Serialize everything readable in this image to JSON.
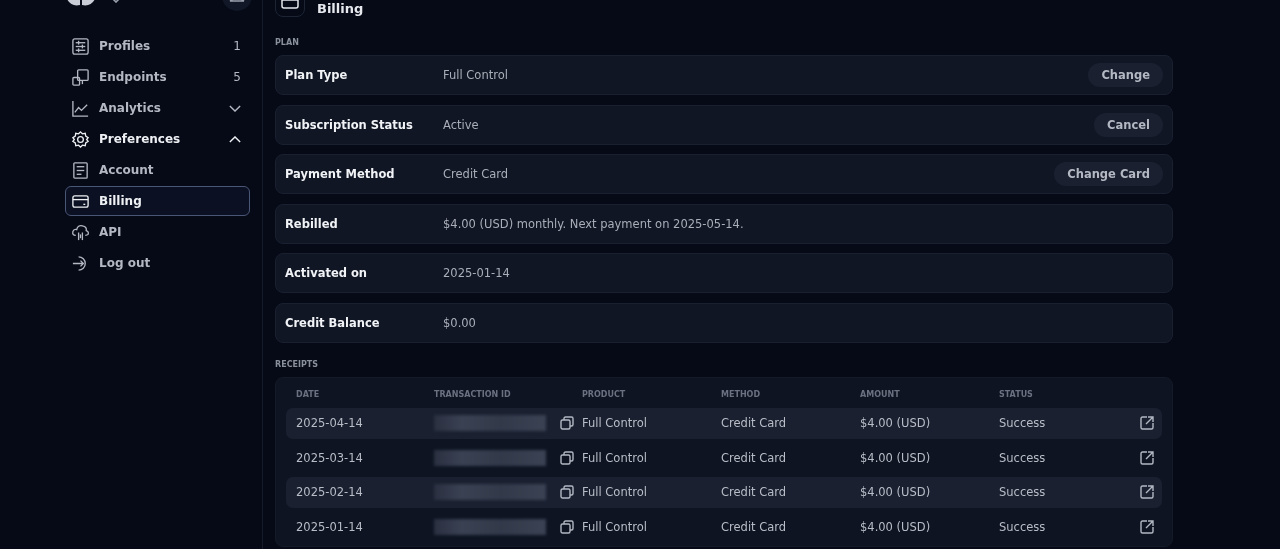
{
  "sidebar": {
    "items": [
      {
        "label": "Profiles",
        "badge": "1",
        "selected": false
      },
      {
        "label": "Endpoints",
        "badge": "5",
        "selected": false
      },
      {
        "label": "Analytics",
        "expanded": false,
        "selected": false
      },
      {
        "label": "Preferences",
        "expanded": true,
        "selected": false
      },
      {
        "label": "Account",
        "selected": false
      },
      {
        "label": "Billing",
        "selected": true
      },
      {
        "label": "API",
        "selected": false
      },
      {
        "label": "Log out",
        "selected": false
      }
    ]
  },
  "page": {
    "title": "Billing"
  },
  "plan": {
    "heading": "PLAN",
    "rows": [
      {
        "label": "Plan Type",
        "value": "Full Control",
        "action": "Change"
      },
      {
        "label": "Subscription Status",
        "value": "Active",
        "action": "Cancel"
      },
      {
        "label": "Payment Method",
        "value": "Credit Card",
        "action": "Change Card"
      },
      {
        "label": "Rebilled",
        "value": "$4.00 (USD) monthly. Next payment on 2025-05-14."
      },
      {
        "label": "Activated on",
        "value": "2025-01-14"
      },
      {
        "label": "Credit Balance",
        "value": "$0.00"
      }
    ]
  },
  "receipts": {
    "heading": "RECEIPTS",
    "columns": [
      "DATE",
      "TRANSACTION ID",
      "PRODUCT",
      "METHOD",
      "AMOUNT",
      "STATUS"
    ],
    "rows": [
      {
        "date": "2025-04-14",
        "product": "Full Control",
        "method": "Credit Card",
        "amount": "$4.00 (USD)",
        "status": "Success"
      },
      {
        "date": "2025-03-14",
        "product": "Full Control",
        "method": "Credit Card",
        "amount": "$4.00 (USD)",
        "status": "Success"
      },
      {
        "date": "2025-02-14",
        "product": "Full Control",
        "method": "Credit Card",
        "amount": "$4.00 (USD)",
        "status": "Success"
      },
      {
        "date": "2025-01-14",
        "product": "Full Control",
        "method": "Credit Card",
        "amount": "$4.00 (USD)",
        "status": "Success"
      }
    ]
  }
}
